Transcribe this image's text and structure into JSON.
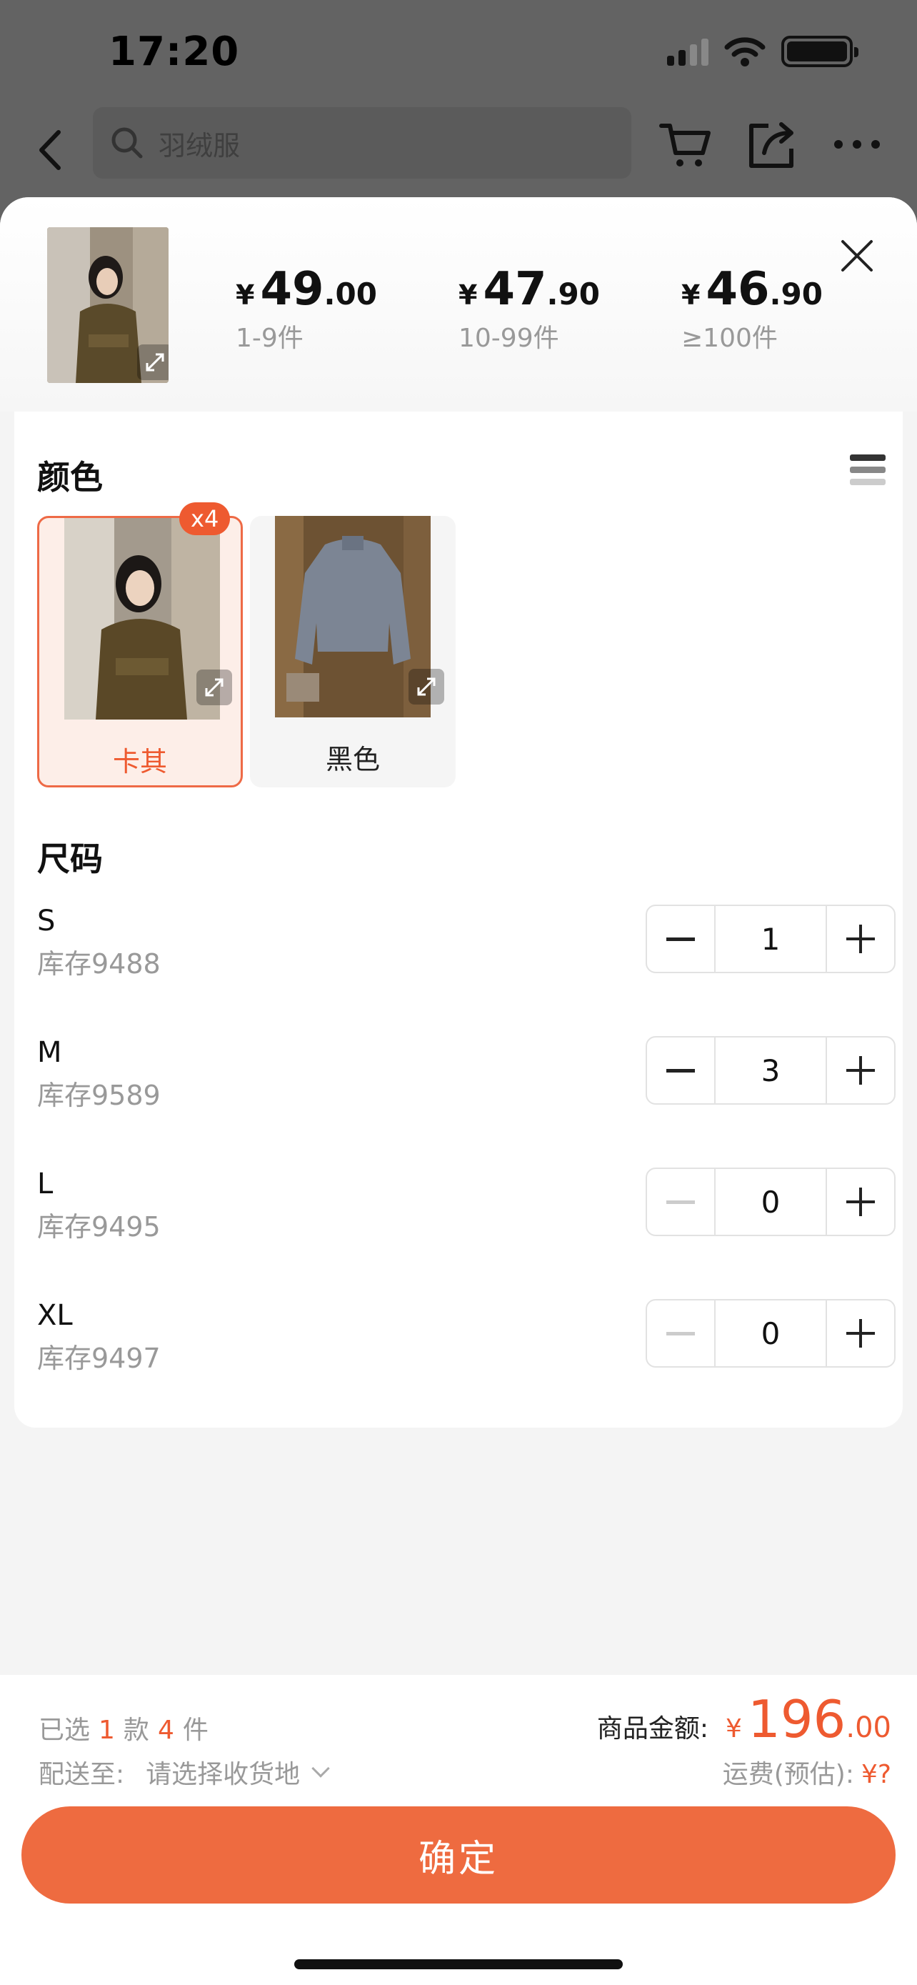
{
  "status_bar": {
    "time": "17:20"
  },
  "nav": {
    "search_placeholder": "羽绒服"
  },
  "price_tiers": [
    {
      "currency": "¥",
      "int": "49",
      "dec": ".00",
      "range": "1-9件"
    },
    {
      "currency": "¥",
      "int": "47",
      "dec": ".90",
      "range": "10-99件"
    },
    {
      "currency": "¥",
      "int": "46",
      "dec": ".90",
      "range": "≥100件"
    }
  ],
  "color_section": {
    "title": "颜色",
    "options": [
      {
        "label": "卡其",
        "badge": "x4",
        "selected": true
      },
      {
        "label": "黑色",
        "selected": false
      }
    ]
  },
  "size_section": {
    "title": "尺码",
    "sizes": [
      {
        "name": "S",
        "stock": "库存9488",
        "qty": "1"
      },
      {
        "name": "M",
        "stock": "库存9589",
        "qty": "3"
      },
      {
        "name": "L",
        "stock": "库存9495",
        "qty": "0"
      },
      {
        "name": "XL",
        "stock": "库存9497",
        "qty": "0"
      }
    ]
  },
  "footer": {
    "selected_prefix": "已选",
    "selected_styles": "1",
    "styles_unit": "款",
    "selected_pieces": "4",
    "pieces_unit": "件",
    "ship_label": "配送至:",
    "ship_value": "请选择收货地",
    "amount_label": "商品金额:",
    "amount_currency": "¥",
    "amount_int": "196",
    "amount_dec": ".00",
    "freight_label": "运费(预估):",
    "freight_value": "¥?",
    "confirm_label": "确定"
  },
  "colors": {
    "accent": "#ee5a30",
    "button": "#ee6b40"
  }
}
